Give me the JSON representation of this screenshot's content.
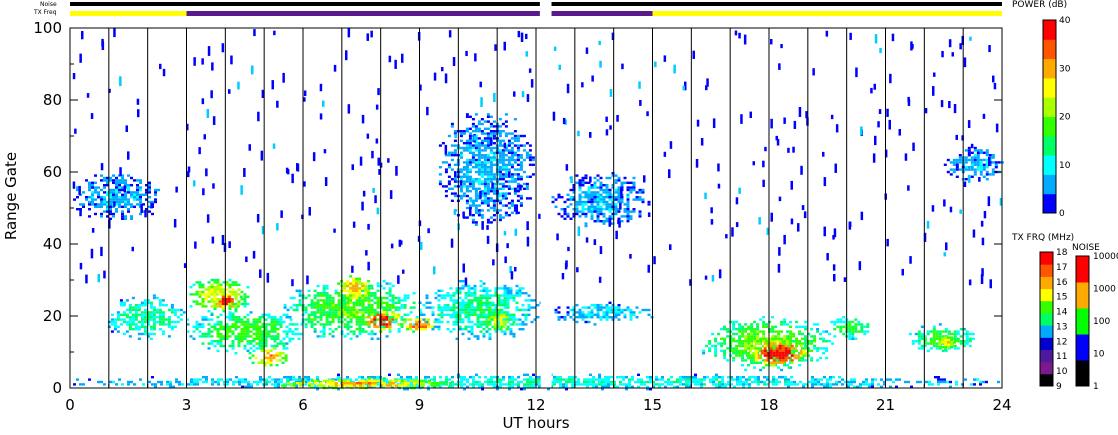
{
  "chart_data": {
    "type": "heatmap",
    "xlabel": "UT hours",
    "ylabel": "Range Gate",
    "xlim": [
      0,
      24
    ],
    "ylim": [
      0,
      100
    ],
    "x_ticks": [
      0,
      3,
      6,
      9,
      12,
      15,
      18,
      21,
      24
    ],
    "y_ticks": [
      0,
      20,
      40,
      60,
      80,
      100
    ],
    "top_rows": {
      "noise_label": "Noise",
      "txfreq_label": "TX Freq"
    },
    "scan_boundaries_ut": [
      1.0,
      2.0,
      3.0,
      4.0,
      5.0,
      6.0,
      7.0,
      8.0,
      9.0,
      10.0,
      11.0,
      12.0,
      13.0,
      14.0,
      15.0,
      16.0,
      17.0,
      18.0,
      19.0,
      20.0,
      21.0,
      22.0,
      23.0
    ],
    "data_gap_ut": [
      12.12,
      12.4
    ],
    "tx_freq_segments": [
      {
        "start": 0,
        "end": 3.0,
        "mhz": 14.8,
        "color": "#ffff00"
      },
      {
        "start": 3.0,
        "end": 12.1,
        "mhz": 10.4,
        "color": "#5a1a8c"
      },
      {
        "start": 12.4,
        "end": 15.0,
        "mhz": 10.4,
        "color": "#5a1a8c"
      },
      {
        "start": 15.0,
        "end": 24,
        "mhz": 14.8,
        "color": "#ffff00"
      }
    ],
    "noise_segments": [
      {
        "start": 0,
        "end": 12.1,
        "level": 1,
        "color": "#000000"
      },
      {
        "start": 12.4,
        "end": 24,
        "level": 1,
        "color": "#000000"
      }
    ],
    "echo_regions": [
      {
        "t0": 0.0,
        "t1": 2.3,
        "g0": 47,
        "g1": 60,
        "power": 6
      },
      {
        "t0": 0.9,
        "t1": 3.0,
        "g0": 14,
        "g1": 26,
        "power": 12
      },
      {
        "t0": 3.0,
        "t1": 4.6,
        "g0": 21,
        "g1": 31,
        "power": 22
      },
      {
        "t0": 3.6,
        "t1": 4.4,
        "g0": 22,
        "g1": 27,
        "power": 33
      },
      {
        "t0": 3.0,
        "t1": 6.0,
        "g0": 10,
        "g1": 22,
        "power": 15
      },
      {
        "t0": 4.6,
        "t1": 5.6,
        "g0": 6,
        "g1": 12,
        "power": 26
      },
      {
        "t0": 5.5,
        "t1": 9.0,
        "g0": 14,
        "g1": 30,
        "power": 16
      },
      {
        "t0": 6.8,
        "t1": 7.8,
        "g0": 24,
        "g1": 32,
        "power": 25
      },
      {
        "t0": 7.5,
        "t1": 8.5,
        "g0": 16,
        "g1": 22,
        "power": 34
      },
      {
        "t0": 8.5,
        "t1": 9.4,
        "g0": 16,
        "g1": 20,
        "power": 30
      },
      {
        "t0": 9.0,
        "t1": 12.1,
        "g0": 14,
        "g1": 30,
        "power": 12
      },
      {
        "t0": 10.6,
        "t1": 11.4,
        "g0": 16,
        "g1": 22,
        "power": 22
      },
      {
        "t0": 12.4,
        "t1": 15.0,
        "g0": 18,
        "g1": 24,
        "power": 8
      },
      {
        "t0": 16.2,
        "t1": 19.6,
        "g0": 5,
        "g1": 20,
        "power": 17
      },
      {
        "t0": 17.4,
        "t1": 19.0,
        "g0": 6,
        "g1": 14,
        "power": 34
      },
      {
        "t0": 19.5,
        "t1": 20.6,
        "g0": 14,
        "g1": 20,
        "power": 15
      },
      {
        "t0": 21.6,
        "t1": 23.3,
        "g0": 10,
        "g1": 18,
        "power": 15
      },
      {
        "t0": 22.2,
        "t1": 22.8,
        "g0": 11,
        "g1": 15,
        "power": 24
      },
      {
        "t0": 9.5,
        "t1": 11.9,
        "g0": 45,
        "g1": 77,
        "power": 6
      },
      {
        "t0": 12.4,
        "t1": 14.9,
        "g0": 45,
        "g1": 60,
        "power": 6
      },
      {
        "t0": 22.5,
        "t1": 24.0,
        "g0": 58,
        "g1": 67,
        "power": 6
      },
      {
        "t0": 0.0,
        "t1": 24.0,
        "g0": 0,
        "g1": 4,
        "power": 10
      },
      {
        "t0": 5.2,
        "t1": 9.8,
        "g0": 0,
        "g1": 3,
        "power": 26
      }
    ],
    "colorbars": {
      "power": {
        "title": "POWER (dB)",
        "ticks": [
          0,
          10,
          20,
          30,
          40
        ],
        "colors": [
          "#0000ff",
          "#00aaff",
          "#00ffff",
          "#00ff66",
          "#33ff00",
          "#aaff00",
          "#ffff00",
          "#ffaa00",
          "#ff5500",
          "#ff0000"
        ]
      },
      "txfreq": {
        "title": "TX FRQ (MHz)",
        "ticks": [
          "9",
          "10",
          "11",
          "12",
          "13",
          "14",
          "15",
          "16",
          "17",
          "18"
        ],
        "colors": [
          "#000000",
          "#7a1a8c",
          "#4d1a9f",
          "#0000cc",
          "#00aaff",
          "#00ff66",
          "#33ff00",
          "#ffff00",
          "#ffaa00",
          "#ff5500",
          "#ff0000"
        ]
      },
      "noise": {
        "title": "NOISE",
        "ticks": [
          "1",
          "10",
          "100",
          "1000",
          "10000"
        ],
        "colors": [
          "#000000",
          "#0000ff",
          "#00ff00",
          "#ffaa00",
          "#ff0000"
        ]
      }
    }
  }
}
